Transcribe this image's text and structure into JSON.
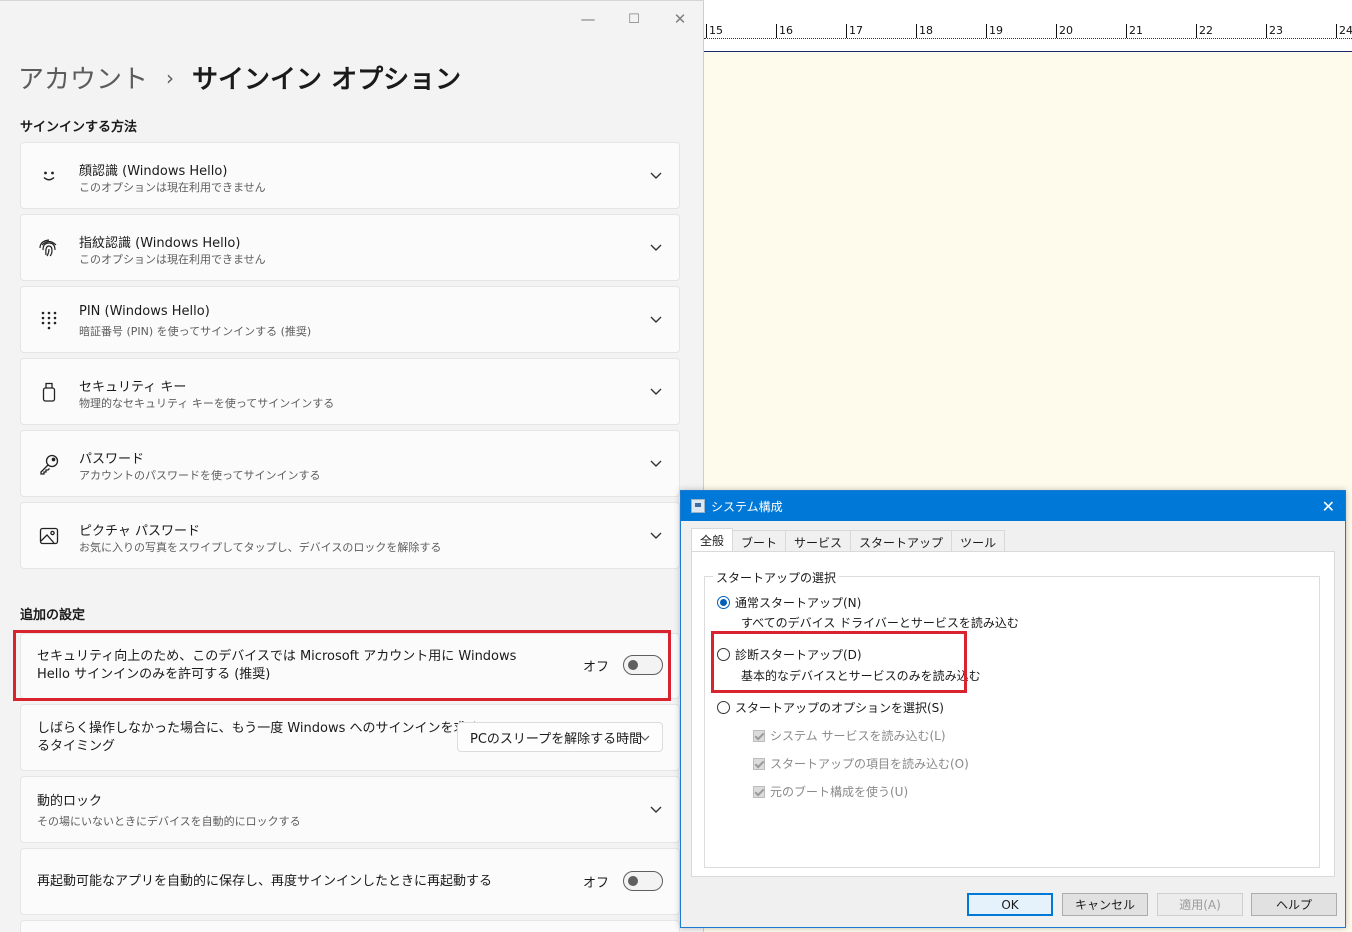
{
  "ruler": {
    "ticks": [
      "15",
      "16",
      "17",
      "18",
      "19",
      "20",
      "21",
      "22",
      "23",
      "24"
    ]
  },
  "settings": {
    "window_controls": {
      "minimize": "—",
      "maximize": "☐",
      "close": "✕"
    },
    "breadcrumb": {
      "parent": "アカウント",
      "separator": "›",
      "current": "サインイン オプション"
    },
    "signin_section_title": "サインインする方法",
    "signin_methods": [
      {
        "icon": "face-icon",
        "title": "顔認識 (Windows Hello)",
        "subtitle": "このオプションは現在利用できません"
      },
      {
        "icon": "fingerprint-icon",
        "title": "指紋認識 (Windows Hello)",
        "subtitle": "このオプションは現在利用できません"
      },
      {
        "icon": "pin-keypad-icon",
        "title": "PIN (Windows Hello)",
        "subtitle": "暗証番号 (PIN) を使ってサインインする (推奨)"
      },
      {
        "icon": "security-key-icon",
        "title": "セキュリティ キー",
        "subtitle": "物理的なセキュリティ キーを使ってサインインする"
      },
      {
        "icon": "key-icon",
        "title": "パスワード",
        "subtitle": "アカウントのパスワードを使ってサインインする"
      },
      {
        "icon": "picture-icon",
        "title": "ピクチャ パスワード",
        "subtitle": "お気に入りの写真をスワイプしてタップし、デバイスのロックを解除する"
      }
    ],
    "additional_section_title": "追加の設定",
    "hello_only": {
      "line1": "セキュリティ向上のため、このデバイスでは Microsoft アカウント用に Windows",
      "line2": "Hello サインインのみを許可する (推奨)",
      "toggle_label": "オフ",
      "toggle_on": false
    },
    "reauth": {
      "line1": "しばらく操作しなかった場合に、もう一度 Windows へのサインインを求め",
      "line2": "るタイミング",
      "dropdown_value": "PCのスリープを解除する時間"
    },
    "dynamic_lock": {
      "title": "動的ロック",
      "subtitle": "その場にいないときにデバイスを自動的にロックする"
    },
    "restart_apps": {
      "text": "再起動可能なアプリを自動的に保存し、再度サインインしたときに再起動する",
      "toggle_label": "オフ",
      "toggle_on": false
    }
  },
  "dialog": {
    "title": "システム構成",
    "close": "✕",
    "tabs": [
      "全般",
      "ブート",
      "サービス",
      "スタートアップ",
      "ツール"
    ],
    "active_tab": "全般",
    "group_label": "スタートアップの選択",
    "options": [
      {
        "label": "通常スタートアップ(N)",
        "desc": "すべてのデバイス ドライバーとサービスを読み込む",
        "selected": true
      },
      {
        "label": "診断スタートアップ(D)",
        "desc": "基本的なデバイスとサービスのみを読み込む",
        "selected": false
      },
      {
        "label": "スタートアップのオプションを選択(S)",
        "desc": "",
        "selected": false
      }
    ],
    "checkboxes": [
      "システム サービスを読み込む(L)",
      "スタートアップの項目を読み込む(O)",
      "元のブート構成を使う(U)"
    ],
    "buttons": {
      "ok": "OK",
      "cancel": "キャンセル",
      "apply": "適用(A)",
      "help": "ヘルプ"
    }
  },
  "colors": {
    "highlight_red": "#d9232e",
    "dialog_titlebar": "#0078d7",
    "page_cream": "#fffbec"
  }
}
